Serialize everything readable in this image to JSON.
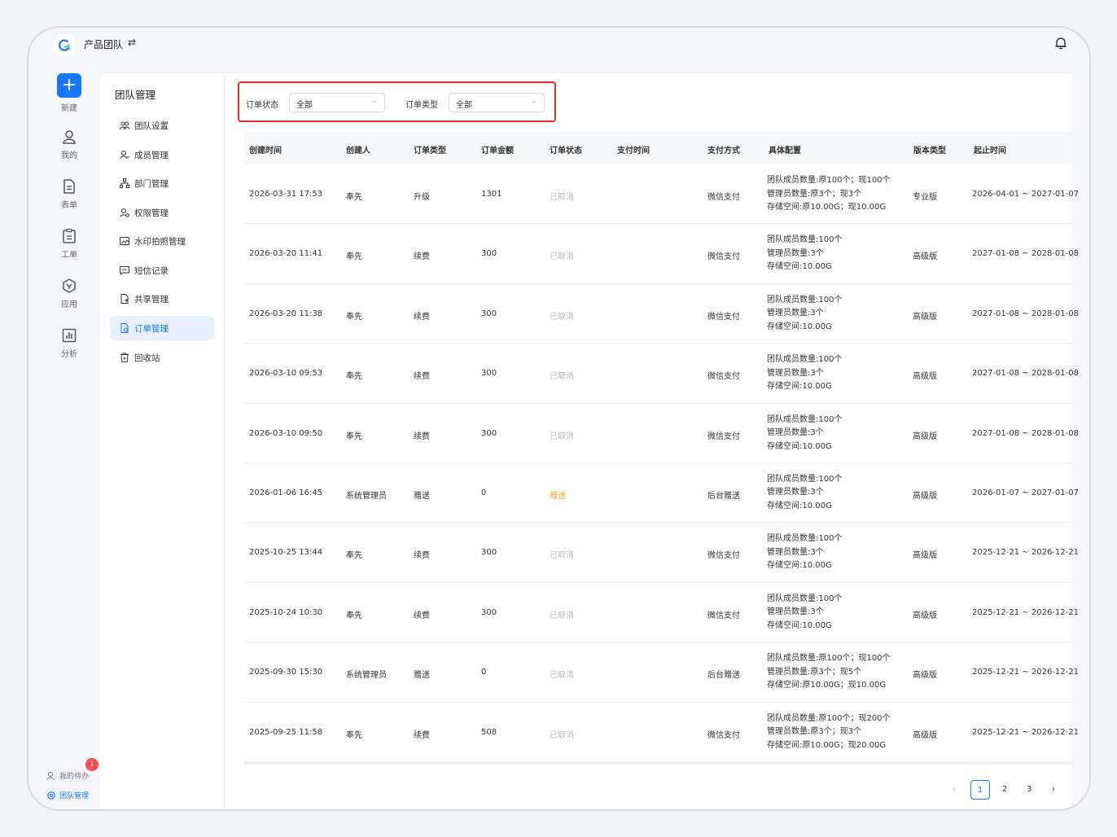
{
  "header": {
    "team_name": "产品团队",
    "swap_glyph": "⇄"
  },
  "leftnav": {
    "items": [
      {
        "label": "新建",
        "icon": "plus-icon"
      },
      {
        "label": "我的",
        "icon": "user-icon"
      },
      {
        "label": "表单",
        "icon": "form-icon"
      },
      {
        "label": "工单",
        "icon": "ticket-icon"
      },
      {
        "label": "应用",
        "icon": "app-icon"
      },
      {
        "label": "分析",
        "icon": "chart-icon"
      }
    ],
    "todo_label": "我的待办",
    "todo_badge": "1",
    "team_admin_label": "团队管理"
  },
  "sidebar": {
    "title": "团队管理",
    "items": [
      {
        "label": "团队设置",
        "icon": "team-icon"
      },
      {
        "label": "成员管理",
        "icon": "member-icon"
      },
      {
        "label": "部门管理",
        "icon": "department-icon"
      },
      {
        "label": "权限管理",
        "icon": "permission-icon"
      },
      {
        "label": "水印拍照管理",
        "icon": "watermark-icon"
      },
      {
        "label": "短信记录",
        "icon": "sms-icon"
      },
      {
        "label": "共享管理",
        "icon": "share-icon"
      },
      {
        "label": "订单管理",
        "icon": "order-icon"
      },
      {
        "label": "回收站",
        "icon": "trash-icon"
      }
    ],
    "active_index": 7
  },
  "filters": {
    "status_label": "订单状态",
    "status_value": "全部",
    "type_label": "订单类型",
    "type_value": "全部"
  },
  "table": {
    "columns": [
      "创建时间",
      "创建人",
      "订单类型",
      "订单金额",
      "订单状态",
      "支付时间",
      "支付方式",
      "具体配置",
      "版本类型",
      "起止时间"
    ],
    "rows": [
      {
        "created": "2026-03-31 17:53",
        "creator": "奉先",
        "type": "升级",
        "amount": "1301",
        "status": "已取消",
        "paid_at": "",
        "method": "微信支付",
        "cfg": [
          "团队成员数量:原100个；现100个",
          "管理员数量:原3个；现3个",
          "存储空间:原10.00G；现10.00G"
        ],
        "edition": "专业版",
        "period": "2026-04-01 ~ 2027-01-07"
      },
      {
        "created": "2026-03-20 11:41",
        "creator": "奉先",
        "type": "续费",
        "amount": "300",
        "status": "已取消",
        "paid_at": "",
        "method": "微信支付",
        "cfg": [
          "团队成员数量:100个",
          "管理员数量:3个",
          "存储空间:10.00G"
        ],
        "edition": "高级版",
        "period": "2027-01-08 ~ 2028-01-08"
      },
      {
        "created": "2026-03-20 11:38",
        "creator": "奉先",
        "type": "续费",
        "amount": "300",
        "status": "已取消",
        "paid_at": "",
        "method": "微信支付",
        "cfg": [
          "团队成员数量:100个",
          "管理员数量:3个",
          "存储空间:10.00G"
        ],
        "edition": "高级版",
        "period": "2027-01-08 ~ 2028-01-08"
      },
      {
        "created": "2026-03-10 09:53",
        "creator": "奉先",
        "type": "续费",
        "amount": "300",
        "status": "已取消",
        "paid_at": "",
        "method": "微信支付",
        "cfg": [
          "团队成员数量:100个",
          "管理员数量:3个",
          "存储空间:10.00G"
        ],
        "edition": "高级版",
        "period": "2027-01-08 ~ 2028-01-08"
      },
      {
        "created": "2026-03-10 09:50",
        "creator": "奉先",
        "type": "续费",
        "amount": "300",
        "status": "已取消",
        "paid_at": "",
        "method": "微信支付",
        "cfg": [
          "团队成员数量:100个",
          "管理员数量:3个",
          "存储空间:10.00G"
        ],
        "edition": "高级版",
        "period": "2027-01-08 ~ 2028-01-08"
      },
      {
        "created": "2026-01-06 16:45",
        "creator": "系统管理员",
        "type": "赠送",
        "amount": "0",
        "status": "赠送",
        "paid_at": "",
        "method": "后台赠送",
        "cfg": [
          "团队成员数量:100个",
          "管理员数量:3个",
          "存储空间:10.00G"
        ],
        "edition": "高级版",
        "period": "2026-01-07 ~ 2027-01-07"
      },
      {
        "created": "2025-10-25 13:44",
        "creator": "奉先",
        "type": "续费",
        "amount": "300",
        "status": "已取消",
        "paid_at": "",
        "method": "微信支付",
        "cfg": [
          "团队成员数量:100个",
          "管理员数量:3个",
          "存储空间:10.00G"
        ],
        "edition": "高级版",
        "period": "2025-12-21 ~ 2026-12-21"
      },
      {
        "created": "2025-10-24 10:30",
        "creator": "奉先",
        "type": "续费",
        "amount": "300",
        "status": "已取消",
        "paid_at": "",
        "method": "微信支付",
        "cfg": [
          "团队成员数量:100个",
          "管理员数量:3个",
          "存储空间:10.00G"
        ],
        "edition": "高级版",
        "period": "2025-12-21 ~ 2026-12-21"
      },
      {
        "created": "2025-09-30 15:30",
        "creator": "系统管理员",
        "type": "赠送",
        "amount": "0",
        "status": "已取消",
        "paid_at": "",
        "method": "后台赠送",
        "cfg": [
          "团队成员数量:原100个；现100个",
          "管理员数量:原3个；现5个",
          "存储空间:原10.00G；现10.00G"
        ],
        "edition": "高级版",
        "period": "2025-12-21 ~ 2026-12-21"
      },
      {
        "created": "2025-09-25 11:58",
        "creator": "奉先",
        "type": "续费",
        "amount": "508",
        "status": "已取消",
        "paid_at": "",
        "method": "微信支付",
        "cfg": [
          "团队成员数量:原100个；现200个",
          "管理员数量:原3个；现3个",
          "存储空间:原10.00G；现20.00G"
        ],
        "edition": "高级版",
        "period": "2025-12-21 ~ 2026-12-21"
      }
    ]
  },
  "pagination": {
    "prev": "‹",
    "pages": [
      "1",
      "2",
      "3"
    ],
    "current": "1",
    "next": "›"
  },
  "colors": {
    "accent": "#1677ff",
    "highlight_border": "#e0302a",
    "gift_status": "#f5a623",
    "cancel_status": "#bbbbbb",
    "badge": "#ff4d4f"
  }
}
